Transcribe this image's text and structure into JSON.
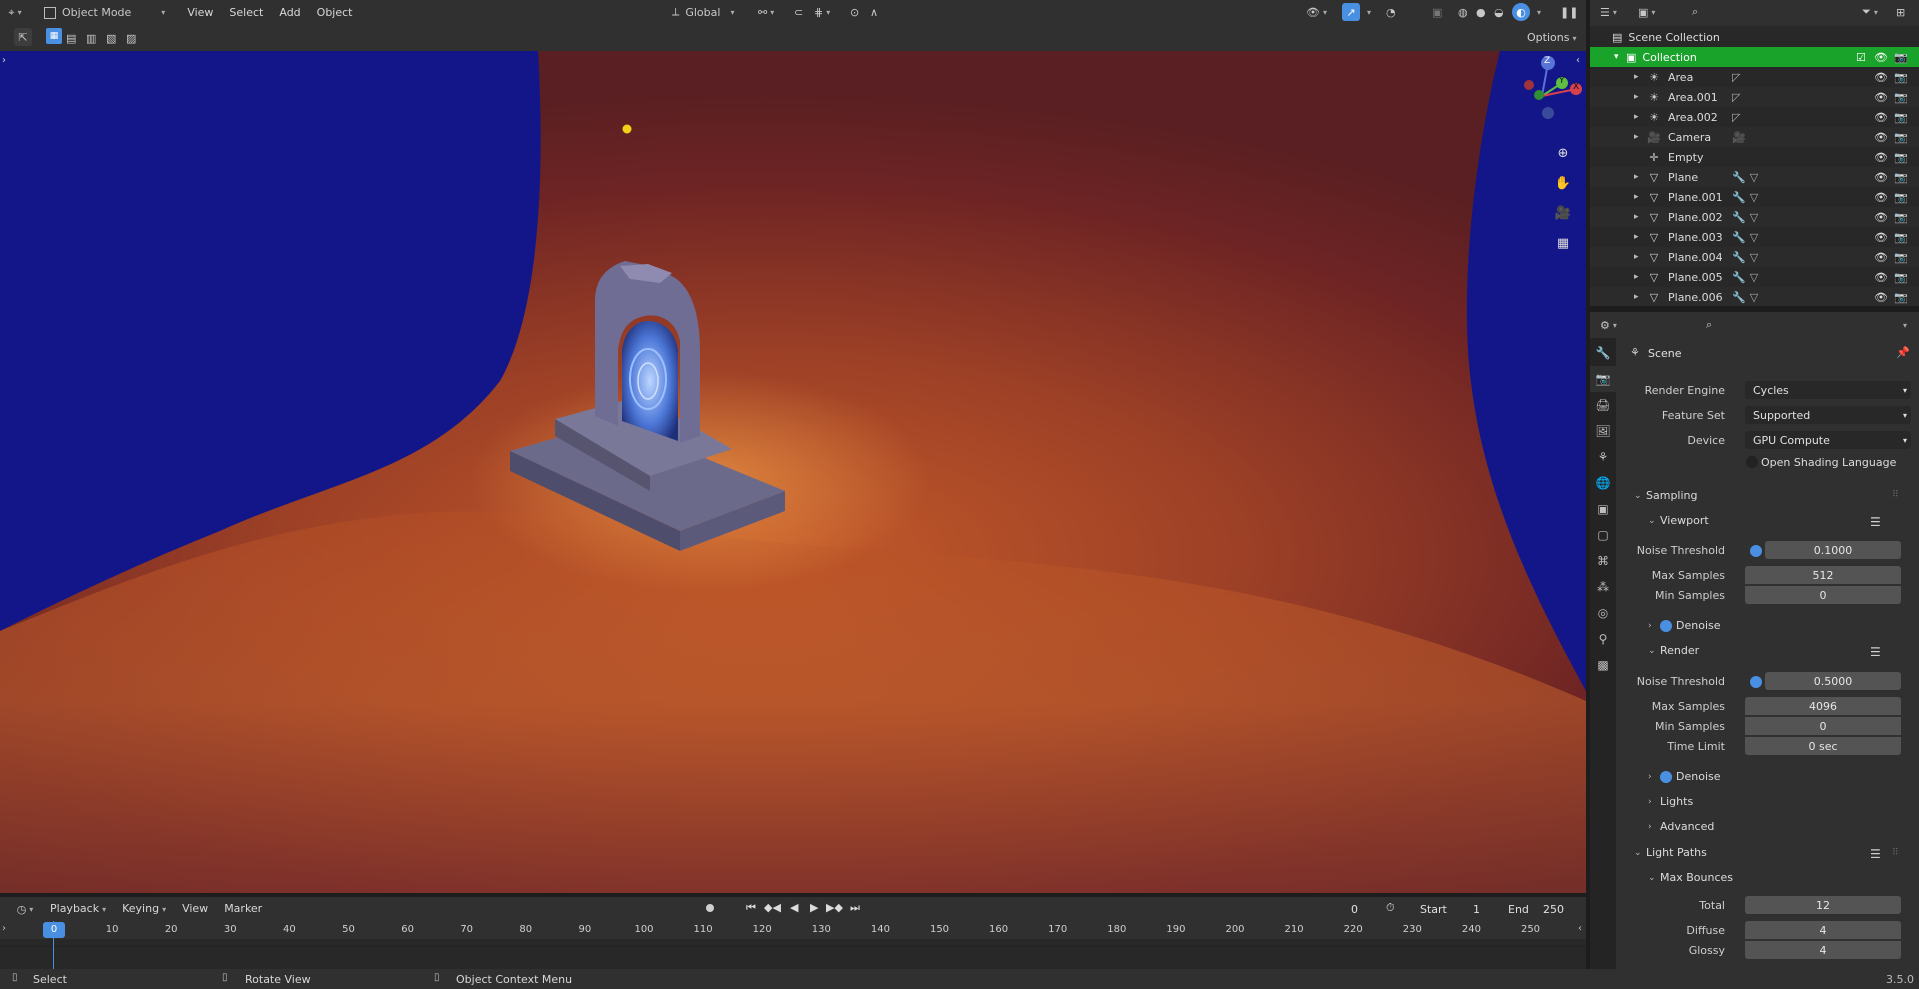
{
  "header": {
    "mode": "Object Mode",
    "menus": [
      "View",
      "Select",
      "Add",
      "Object"
    ],
    "orientation": "Global",
    "options_label": "Options"
  },
  "viewport": {
    "gizmo": {
      "z": "Z",
      "y": "Y",
      "x": "X"
    }
  },
  "timeline": {
    "menus": [
      "Playback",
      "Keying",
      "View",
      "Marker"
    ],
    "current_frame": "0",
    "start_label": "Start",
    "start": "1",
    "end_label": "End",
    "end": "250",
    "ruler": [
      "0",
      "10",
      "20",
      "30",
      "40",
      "50",
      "60",
      "70",
      "80",
      "90",
      "100",
      "110",
      "120",
      "130",
      "140",
      "150",
      "160",
      "170",
      "180",
      "190",
      "200",
      "210",
      "220",
      "230",
      "240",
      "250"
    ],
    "playhead": "0"
  },
  "statusbar": {
    "select": "Select",
    "rotate": "Rotate View",
    "context": "Object Context Menu",
    "version": "3.5.0"
  },
  "outliner": {
    "scene_collection": "Scene Collection",
    "collection": "Collection",
    "items": [
      {
        "name": "Area",
        "icon": "light-icon"
      },
      {
        "name": "Area.001",
        "icon": "light-icon"
      },
      {
        "name": "Area.002",
        "icon": "light-icon"
      },
      {
        "name": "Camera",
        "icon": "camera-icon"
      },
      {
        "name": "Empty",
        "icon": "empty-icon"
      },
      {
        "name": "Plane",
        "icon": "mesh-icon"
      },
      {
        "name": "Plane.001",
        "icon": "mesh-icon"
      },
      {
        "name": "Plane.002",
        "icon": "mesh-icon"
      },
      {
        "name": "Plane.003",
        "icon": "mesh-icon"
      },
      {
        "name": "Plane.004",
        "icon": "mesh-icon"
      },
      {
        "name": "Plane.005",
        "icon": "mesh-icon"
      },
      {
        "name": "Plane.006",
        "icon": "mesh-icon"
      }
    ]
  },
  "properties": {
    "context": "Scene",
    "render_engine_label": "Render Engine",
    "render_engine": "Cycles",
    "feature_set_label": "Feature Set",
    "feature_set": "Supported",
    "device_label": "Device",
    "device": "GPU Compute",
    "osl_label": "Open Shading Language",
    "sampling": "Sampling",
    "viewport": "Viewport",
    "noise_threshold_label": "Noise Threshold",
    "vp_noise_threshold": "0.1000",
    "max_samples_label": "Max Samples",
    "vp_max_samples": "512",
    "min_samples_label": "Min Samples",
    "vp_min_samples": "0",
    "denoise": "Denoise",
    "render": "Render",
    "r_noise_threshold": "0.5000",
    "r_max_samples": "4096",
    "r_min_samples": "0",
    "time_limit_label": "Time Limit",
    "r_time_limit": "0 sec",
    "lights": "Lights",
    "advanced": "Advanced",
    "light_paths": "Light Paths",
    "max_bounces": "Max Bounces",
    "total_label": "Total",
    "total": "12",
    "diffuse_label": "Diffuse",
    "diffuse": "4",
    "glossy_label": "Glossy",
    "glossy": "4"
  },
  "colors": {
    "accent": "#4a90e2",
    "collection_highlight": "#1aa32b"
  }
}
